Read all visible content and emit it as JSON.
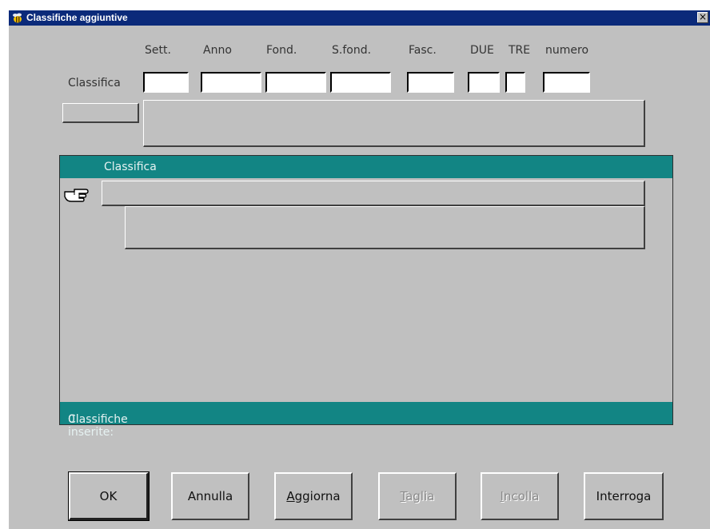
{
  "window": {
    "title": "Classifiche aggiuntive",
    "close_glyph": "×",
    "icon": "bee-icon"
  },
  "form": {
    "columns": [
      "Sett.",
      "Anno",
      "Fond.",
      "S.fond.",
      "Fasc.",
      "DUE",
      "TRE",
      "numero"
    ],
    "row_label": "Classifica",
    "fields": [
      "",
      "",
      "",
      "",
      "",
      "",
      "",
      ""
    ]
  },
  "grid": {
    "header": "Classifica",
    "footer_label": "Classifiche inserite: ",
    "footer_count": "0",
    "row_indicator_icon": "pointing-hand-icon"
  },
  "buttons": {
    "ok": "OK",
    "annulla": "Annulla",
    "aggiorna": {
      "first": "A",
      "rest": "ggiorna"
    },
    "taglia": {
      "first": "T",
      "rest": "aglia"
    },
    "incolla": {
      "first": "I",
      "rest": "ncolla"
    },
    "interroga": "Interroga"
  },
  "colors": {
    "title_bar": "#0b2a7a",
    "grid_band": "#128584",
    "dialog_bg": "#c0c0c0"
  }
}
